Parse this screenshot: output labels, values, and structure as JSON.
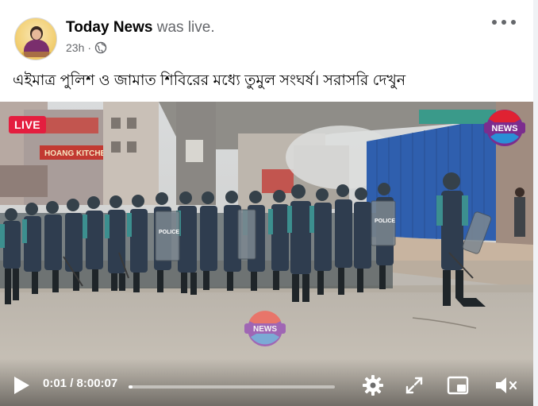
{
  "post": {
    "page_name": "Today News",
    "status": "was live.",
    "time": "23h",
    "audience_icon": "globe-icon",
    "caption": "এইমাত্র পুলিশ ও জামাত শিবিরের মধ্যে তুমুল সংঘর্ষ। সরাসরি দেখুন"
  },
  "video": {
    "live_label": "LIVE",
    "logo_text": "NEWS",
    "watermark_text": "NEWS",
    "sign_text": "POLICE",
    "shop_sign": "HOANG KITCHEN",
    "current_time": "0:01",
    "duration": "8:00:07",
    "time_display": "0:01 / 8:00:07",
    "progress": 0.02
  },
  "colors": {
    "live_red": "#e41e3f",
    "uniform_teal": "#3c8f8f",
    "logo_purple": "#7b2d8e",
    "logo_red": "#e02232"
  },
  "controls": {
    "icons": [
      "play-icon",
      "settings-gear-icon",
      "fullscreen-expand-icon",
      "picture-in-picture-icon",
      "volume-muted-icon"
    ]
  }
}
